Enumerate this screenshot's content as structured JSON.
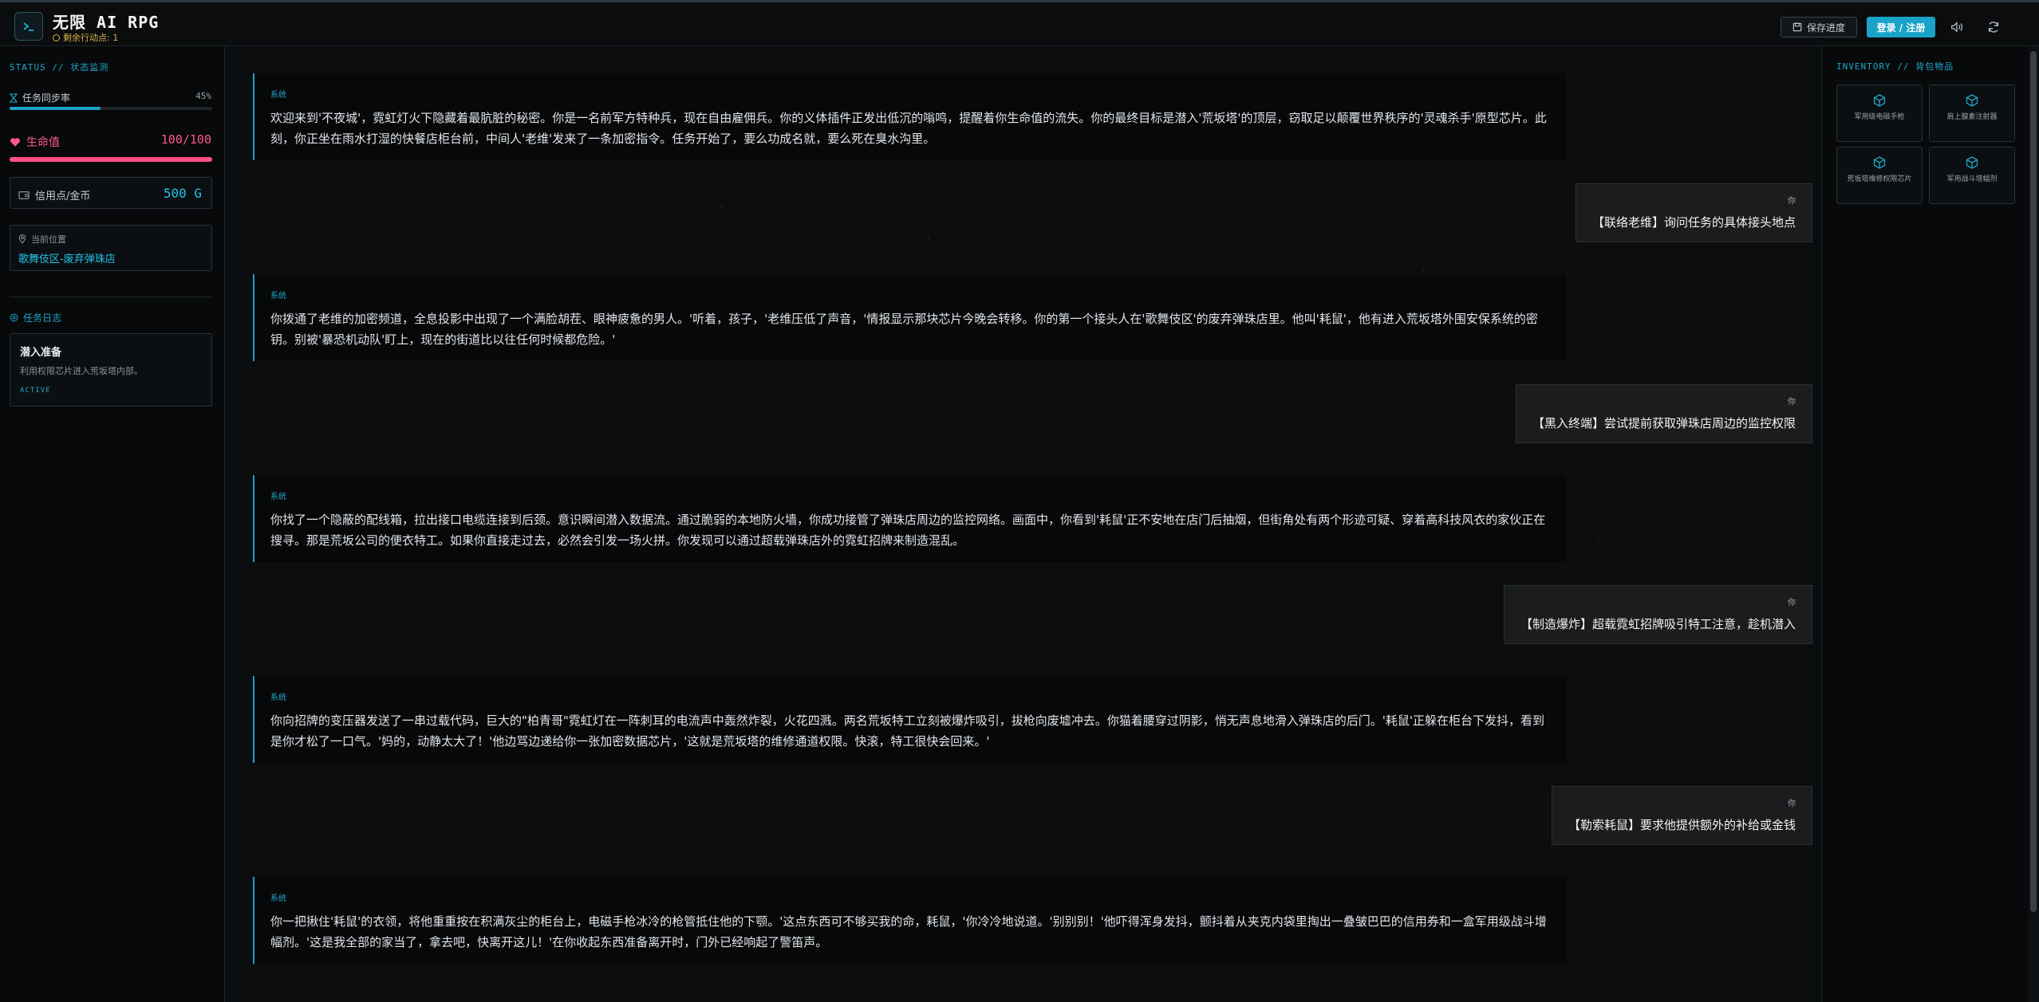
{
  "header": {
    "title": "无限 AI RPG",
    "action_points": "剩余行动点: 1",
    "save_label": "保存进度",
    "login_label": "登录 / 注册",
    "accent": "#1aa3c9"
  },
  "status": {
    "heading": "STATUS // 状态监测",
    "sync_label": "任务同步率",
    "sync_percent": "45%",
    "sync_value": 0.45,
    "hp_label": "生命值",
    "hp_value": "100/100",
    "hp_fraction": 1.0,
    "credits_label": "信用点/金币",
    "credits_value": "500 G",
    "location_label": "当前位置",
    "location_value": "歌舞伎区-废弃弹珠店"
  },
  "quests": {
    "heading": "任务日志",
    "items": [
      {
        "title": "潜入准备",
        "desc": "利用权限芯片进入荒坂塔内部。",
        "status": "ACTIVE"
      }
    ]
  },
  "messages": [
    {
      "role": "system",
      "tag": "系统",
      "text": "欢迎来到'不夜城'，霓虹灯火下隐藏着最肮脏的秘密。你是一名前军方特种兵，现在自由雇佣兵。你的义体插件正发出低沉的嗡鸣，提醒着你生命值的流失。你的最终目标是潜入'荒坂塔'的顶层，窃取足以颠覆世界秩序的'灵魂杀手'原型芯片。此刻，你正坐在雨水打湿的快餐店柜台前，中间人'老维'发来了一条加密指令。任务开始了，要么功成名就，要么死在臭水沟里。"
    },
    {
      "role": "user",
      "tag": "你",
      "text": "【联络老维】询问任务的具体接头地点"
    },
    {
      "role": "system",
      "tag": "系统",
      "text": "你拨通了老维的加密频道，全息投影中出现了一个满脸胡茬、眼神疲惫的男人。'听着，孩子，'老维压低了声音，'情报显示那块芯片今晚会转移。你的第一个接头人在'歌舞伎区'的废弃弹珠店里。他叫'耗鼠'，他有进入荒坂塔外围安保系统的密钥。别被'暴恐机动队'盯上，现在的街道比以往任何时候都危险。'"
    },
    {
      "role": "user",
      "tag": "你",
      "text": "【黑入终端】尝试提前获取弹珠店周边的监控权限"
    },
    {
      "role": "system",
      "tag": "系统",
      "text": "你找了一个隐蔽的配线箱，拉出接口电缆连接到后颈。意识瞬间潜入数据流。通过脆弱的本地防火墙，你成功接管了弹珠店周边的监控网络。画面中，你看到'耗鼠'正不安地在店门后抽烟，但街角处有两个形迹可疑、穿着高科技风衣的家伙正在搜寻。那是荒坂公司的便衣特工。如果你直接走过去，必然会引发一场火拼。你发现可以通过超载弹珠店外的霓虹招牌来制造混乱。"
    },
    {
      "role": "user",
      "tag": "你",
      "text": "【制造爆炸】超载霓虹招牌吸引特工注意，趁机潜入"
    },
    {
      "role": "system",
      "tag": "系统",
      "text": "你向招牌的变压器发送了一串过载代码，巨大的\"柏青哥\"霓虹灯在一阵刺耳的电流声中轰然炸裂，火花四溅。两名荒坂特工立刻被爆炸吸引，拔枪向废墟冲去。你猫着腰穿过阴影，悄无声息地滑入弹珠店的后门。'耗鼠'正躲在柜台下发抖，看到是你才松了一口气。'妈的，动静太大了！'他边骂边递给你一张加密数据芯片，'这就是荒坂塔的维修通道权限。快滚，特工很快会回来。'"
    },
    {
      "role": "user",
      "tag": "你",
      "text": "【勒索耗鼠】要求他提供额外的补给或金钱"
    },
    {
      "role": "system",
      "tag": "系统",
      "text": "你一把揪住'耗鼠'的衣领，将他重重按在积满灰尘的柜台上，电磁手枪冰冷的枪管抵住他的下颚。'这点东西可不够买我的命，耗鼠，'你冷冷地说道。'别别别！'他吓得浑身发抖，颤抖着从夹克内袋里掏出一叠皱巴巴的信用券和一盒军用级战斗增幅剂。'这是我全部的家当了，拿去吧，快离开这儿！'在你收起东西准备离开时，门外已经响起了警笛声。"
    }
  ],
  "inventory": {
    "heading": "INVENTORY // 背包物品",
    "items": [
      {
        "name": "军用级电磁手枪"
      },
      {
        "name": "肩上腺素注射器"
      },
      {
        "name": "荒坂塔维修权限芯片"
      },
      {
        "name": "军用战斗增幅剂"
      }
    ]
  }
}
